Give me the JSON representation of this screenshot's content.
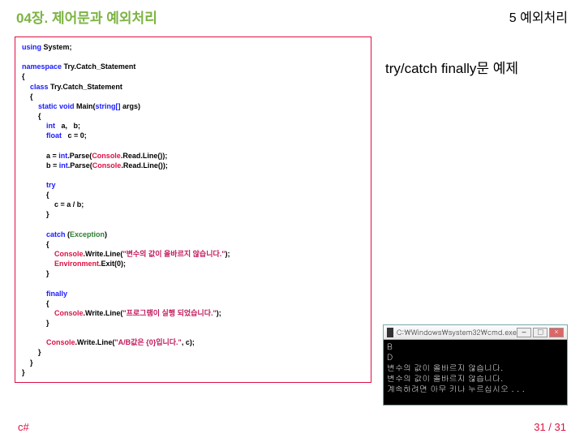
{
  "header": {
    "left": "04장. 제어문과 예외처리",
    "right": "5 예외처리"
  },
  "callout": "try/catch finally문 예제",
  "code": {
    "l1a": "using",
    "l1b": " System;",
    "l2a": "namespace",
    "l2b": " Try.Catch_Statement",
    "l3": "{",
    "l4a": "    class",
    "l4b": " Try.Catch_Statement",
    "l5": "    {",
    "l6a": "        static void",
    "l6b": " Main(",
    "l6c": "string[]",
    "l6d": " args)",
    "l7": "        {",
    "l8a": "            int",
    "l8b": "   a,   b;",
    "l9a": "            float",
    "l9b": "   c = 0;",
    "l10a": "            a = ",
    "l10b": "int",
    "l10c": ".Parse(",
    "l10d": "Console",
    "l10e": ".Read.Line());",
    "l11a": "            b = ",
    "l11b": "int",
    "l11c": ".Parse(",
    "l11d": "Console",
    "l11e": ".Read.Line());",
    "l12": "            try",
    "l13": "            {",
    "l14": "                c = a / b;",
    "l15": "            }",
    "l16a": "            catch",
    "l16b": " (",
    "l16c": "Exception",
    "l16d": ")",
    "l17": "            {",
    "l18a": "                Console",
    "l18b": ".Write.Line(",
    "l18c": "\"변수의 값이 올바르지 않습니다.\"",
    "l18d": ");",
    "l19a": "                Environment",
    "l19b": ".Exit(0);",
    "l20": "            }",
    "l21": "            finally",
    "l22": "            {",
    "l23a": "                Console",
    "l23b": ".Write.Line(",
    "l23c": "\"프로그램이 실행 되었습니다.\"",
    "l23d": ");",
    "l24": "            }",
    "l25a": "            Console",
    "l25b": ".Write.Line(",
    "l25c": "\"A/B값은 {0}입니다.\"",
    "l25d": ", c);",
    "l26": "        }",
    "l27": "    }",
    "l28": "}"
  },
  "screenshot": {
    "title": "C:\\Windows\\system32\\cmd.exe",
    "btn_min": "‒",
    "btn_max": "□",
    "btn_close": "×",
    "line1": "B",
    "line2": "D",
    "line3": "변수의 값이 올바르지 않습니다.",
    "line4": "변수의 값이 올바르지 않습니다.",
    "line5": "계속하려면 아무 키나 누르십시오 . . ."
  },
  "footer": {
    "left": "c#",
    "right": "31 / 31"
  }
}
